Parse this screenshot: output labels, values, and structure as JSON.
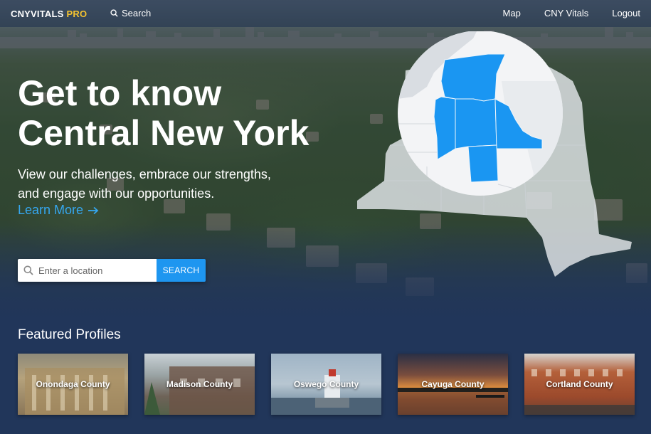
{
  "brand": {
    "part1": "CNYVITALS",
    "part2": "PRO",
    "accent_color": "#f4c330"
  },
  "nav": {
    "search_label": "Search",
    "search_icon": "search-icon",
    "links": [
      "Map",
      "CNY Vitals",
      "Logout"
    ]
  },
  "hero": {
    "headline_line1": "Get to know",
    "headline_line2": "Central New York",
    "subhead_line1": "View our challenges, embrace our strengths,",
    "subhead_line2": "and engage with our opportunities.",
    "learn_more": "Learn More",
    "learn_more_icon": "arrow-right-icon",
    "link_color": "#35a7f0"
  },
  "search": {
    "placeholder": "Enter a location",
    "button_label": "SEARCH",
    "button_color": "#1e96f0"
  },
  "map": {
    "highlight_color": "#1a96f2",
    "background_state_color": "#e3e6ea"
  },
  "featured": {
    "title": "Featured Profiles",
    "profiles": [
      "Onondaga County",
      "Madison County",
      "Oswego County",
      "Cayuga County",
      "Cortland County"
    ]
  },
  "colors": {
    "page_background": "#21365a"
  }
}
